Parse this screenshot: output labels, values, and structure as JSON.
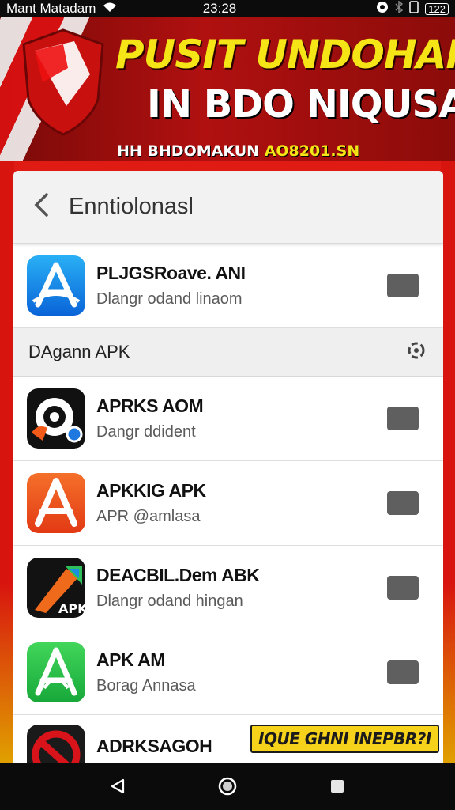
{
  "status_bar": {
    "carrier": "Mant Matadam",
    "time": "23:28",
    "battery": "122",
    "icons": [
      "wifi-icon",
      "location-icon",
      "bluetooth-icon",
      "sim-icon",
      "battery-icon"
    ]
  },
  "banner": {
    "line1": "PUSIT UNDOHAN",
    "line2": "IN BDO NIQUSA",
    "line2_mark": "!",
    "sub_white": "HH BHDOMAKUN",
    "sub_yellow": "AO8201.SN",
    "colors": {
      "yellow": "#f5e416",
      "red": "#b01010"
    }
  },
  "header": {
    "title": "Enntiolonasl",
    "back_icon": "chevron-left-icon"
  },
  "featured": {
    "name": "PLJGSRoave. ANI",
    "desc": "Dlangr odand linaom",
    "icon": "app-store-a-icon"
  },
  "section": {
    "title": "DAgann APK",
    "icon": "refresh-icon"
  },
  "apps": [
    {
      "name": "APRKS AOM",
      "desc": "Dangr ddident",
      "icon": "target-lens-icon"
    },
    {
      "name": "APKKIG APK",
      "desc": "APR @amlasa",
      "icon": "orange-a-icon"
    },
    {
      "name": "DEACBIL.Dem ABK",
      "desc": "Dlangr odand hingan",
      "icon": "apk-wrench-icon"
    },
    {
      "name": "APK AM",
      "desc": "Borag Annasa",
      "icon": "green-a-icon"
    }
  ],
  "last_app": {
    "name": "ADRKSAGOH",
    "icon": "red-circle-icon"
  },
  "cta": {
    "label": "IQUE GHNI INEPBR?I"
  },
  "nav": {
    "back_icon": "nav-back-icon",
    "home_icon": "nav-home-icon",
    "recents_icon": "nav-recents-icon"
  }
}
